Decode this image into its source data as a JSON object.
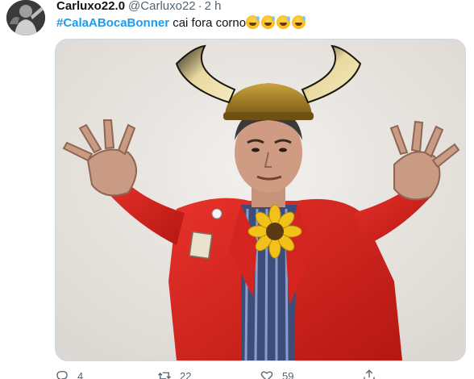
{
  "tweet": {
    "display_name": "Carluxo22.0",
    "handle": "@Carluxo22",
    "separator": "·",
    "time": "2 h",
    "hashtag": "#CalaABocaBonner",
    "text": "cai fora corno",
    "emoji_count": 4,
    "emoji_name": "grinning-face-with-sweat-icon"
  },
  "media": {
    "icon": "photo-demon-horns-red-jacket"
  },
  "actions": {
    "reply_count": "4",
    "retweet_count": "22",
    "like_count": "59"
  },
  "colors": {
    "link": "#1d9bf0",
    "muted": "#536471",
    "border": "#cfd9de"
  }
}
